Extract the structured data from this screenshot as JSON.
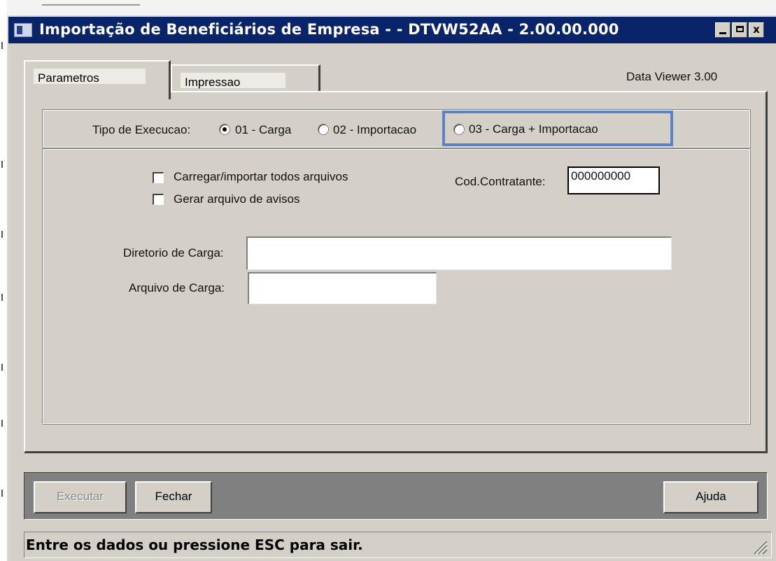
{
  "window": {
    "title": "Importação de Beneficiários de Empresa - - DTVW52AA - 2.00.00.000",
    "controls": {
      "minimize": "_",
      "maximize": "□",
      "close": "x"
    }
  },
  "tabs": [
    {
      "label": "Parametros",
      "active": true
    },
    {
      "label": "Impressao",
      "active": false
    }
  ],
  "version_label": "Data Viewer 3.00",
  "execution_type": {
    "label": "Tipo de Execucao:",
    "options": [
      {
        "label": "01 - Carga",
        "selected": true
      },
      {
        "label": "02 - Importacao",
        "selected": false
      },
      {
        "label": "03 - Carga + Importacao",
        "selected": false
      }
    ]
  },
  "checkboxes": [
    {
      "label": "Carregar/importar todos arquivos",
      "checked": false
    },
    {
      "label": "Gerar arquivo de avisos",
      "checked": false
    }
  ],
  "cod_contratante": {
    "label": "Cod.Contratante:",
    "value": "000000000"
  },
  "diretorio_carga": {
    "label": "Diretorio de Carga:",
    "value": ""
  },
  "arquivo_carga": {
    "label": "Arquivo de Carga:",
    "value": ""
  },
  "buttons": {
    "executar": "Executar",
    "fechar": "Fechar",
    "ajuda": "Ajuda"
  },
  "status": "Entre os dados ou pressione ESC para sair.",
  "colors": {
    "titlebar": "#0a246a",
    "highlight": "#5b82c9",
    "face": "#d4d0c8"
  }
}
